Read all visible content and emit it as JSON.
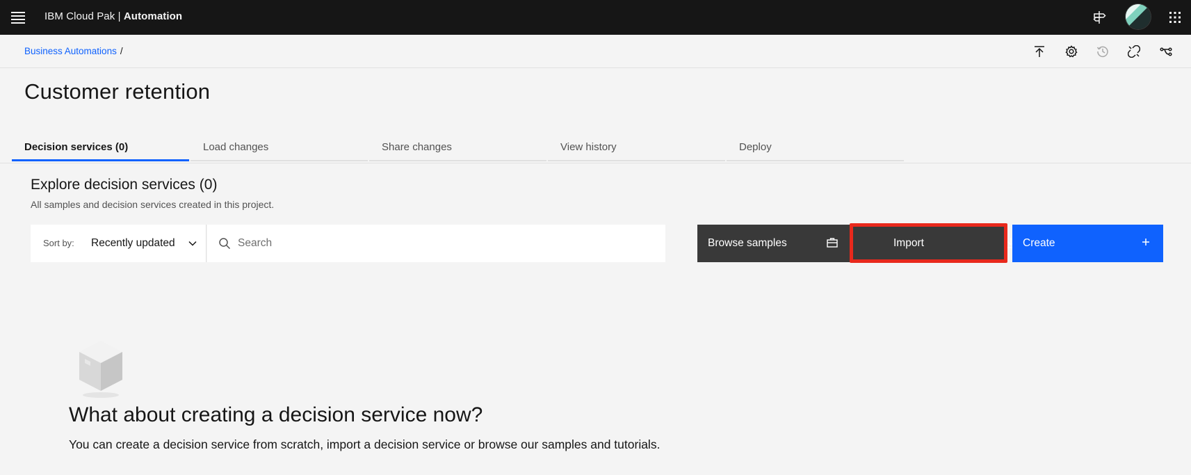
{
  "header": {
    "brand_prefix": "IBM Cloud Pak | ",
    "brand_product": "Automation"
  },
  "breadcrumb": {
    "items": [
      {
        "label": "Business Automations"
      }
    ],
    "separator": "/"
  },
  "page": {
    "title": "Customer retention"
  },
  "tabs": [
    {
      "label": "Decision services (0)",
      "active": true
    },
    {
      "label": "Load changes",
      "active": false
    },
    {
      "label": "Share changes",
      "active": false
    },
    {
      "label": "View history",
      "active": false
    },
    {
      "label": "Deploy",
      "active": false
    }
  ],
  "section": {
    "title": "Explore decision services (0)",
    "subtitle": "All samples and decision services created in this project."
  },
  "toolbar": {
    "sort_label": "Sort by:",
    "sort_value": "Recently updated",
    "search_placeholder": "Search",
    "search_value": "",
    "browse_label": "Browse samples",
    "import_label": "Import",
    "create_label": "Create"
  },
  "empty_state": {
    "title": "What about creating a decision service now?",
    "description": "You can create a decision service from scratch, import a decision service or browse our samples and tutorials."
  },
  "icons": {
    "menu": "menu-icon",
    "signpost": "signpost-icon",
    "app_switcher": "app-switcher-icon",
    "publish": "upload-icon",
    "settings": "gear-icon",
    "history": "history-icon",
    "disconnect": "unlink-icon",
    "branch": "branch-icon",
    "search": "search-icon",
    "sort_chevron": "chevron-down-icon",
    "browse": "briefcase-icon",
    "import": "download-icon",
    "create": "plus-icon",
    "empty": "box-icon"
  },
  "colors": {
    "header_bg": "#161616",
    "page_bg": "#f4f4f4",
    "accent": "#0f62fe",
    "secondary_button": "#393939",
    "highlight": "#e8291c"
  }
}
